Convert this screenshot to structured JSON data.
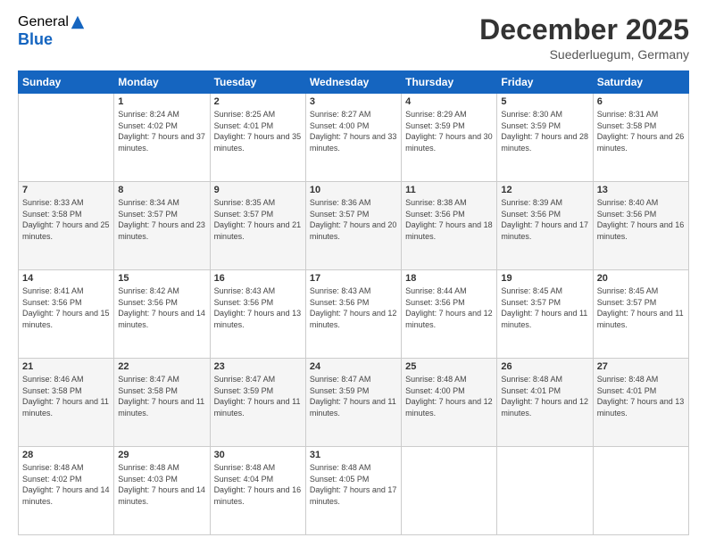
{
  "header": {
    "logo": {
      "general": "General",
      "blue": "Blue"
    },
    "title": "December 2025",
    "subtitle": "Suederluegum, Germany"
  },
  "calendar": {
    "days_of_week": [
      "Sunday",
      "Monday",
      "Tuesday",
      "Wednesday",
      "Thursday",
      "Friday",
      "Saturday"
    ],
    "weeks": [
      [
        {
          "day": "",
          "sunrise": "",
          "sunset": "",
          "daylight": ""
        },
        {
          "day": "1",
          "sunrise": "Sunrise: 8:24 AM",
          "sunset": "Sunset: 4:02 PM",
          "daylight": "Daylight: 7 hours and 37 minutes."
        },
        {
          "day": "2",
          "sunrise": "Sunrise: 8:25 AM",
          "sunset": "Sunset: 4:01 PM",
          "daylight": "Daylight: 7 hours and 35 minutes."
        },
        {
          "day": "3",
          "sunrise": "Sunrise: 8:27 AM",
          "sunset": "Sunset: 4:00 PM",
          "daylight": "Daylight: 7 hours and 33 minutes."
        },
        {
          "day": "4",
          "sunrise": "Sunrise: 8:29 AM",
          "sunset": "Sunset: 3:59 PM",
          "daylight": "Daylight: 7 hours and 30 minutes."
        },
        {
          "day": "5",
          "sunrise": "Sunrise: 8:30 AM",
          "sunset": "Sunset: 3:59 PM",
          "daylight": "Daylight: 7 hours and 28 minutes."
        },
        {
          "day": "6",
          "sunrise": "Sunrise: 8:31 AM",
          "sunset": "Sunset: 3:58 PM",
          "daylight": "Daylight: 7 hours and 26 minutes."
        }
      ],
      [
        {
          "day": "7",
          "sunrise": "Sunrise: 8:33 AM",
          "sunset": "Sunset: 3:58 PM",
          "daylight": "Daylight: 7 hours and 25 minutes."
        },
        {
          "day": "8",
          "sunrise": "Sunrise: 8:34 AM",
          "sunset": "Sunset: 3:57 PM",
          "daylight": "Daylight: 7 hours and 23 minutes."
        },
        {
          "day": "9",
          "sunrise": "Sunrise: 8:35 AM",
          "sunset": "Sunset: 3:57 PM",
          "daylight": "Daylight: 7 hours and 21 minutes."
        },
        {
          "day": "10",
          "sunrise": "Sunrise: 8:36 AM",
          "sunset": "Sunset: 3:57 PM",
          "daylight": "Daylight: 7 hours and 20 minutes."
        },
        {
          "day": "11",
          "sunrise": "Sunrise: 8:38 AM",
          "sunset": "Sunset: 3:56 PM",
          "daylight": "Daylight: 7 hours and 18 minutes."
        },
        {
          "day": "12",
          "sunrise": "Sunrise: 8:39 AM",
          "sunset": "Sunset: 3:56 PM",
          "daylight": "Daylight: 7 hours and 17 minutes."
        },
        {
          "day": "13",
          "sunrise": "Sunrise: 8:40 AM",
          "sunset": "Sunset: 3:56 PM",
          "daylight": "Daylight: 7 hours and 16 minutes."
        }
      ],
      [
        {
          "day": "14",
          "sunrise": "Sunrise: 8:41 AM",
          "sunset": "Sunset: 3:56 PM",
          "daylight": "Daylight: 7 hours and 15 minutes."
        },
        {
          "day": "15",
          "sunrise": "Sunrise: 8:42 AM",
          "sunset": "Sunset: 3:56 PM",
          "daylight": "Daylight: 7 hours and 14 minutes."
        },
        {
          "day": "16",
          "sunrise": "Sunrise: 8:43 AM",
          "sunset": "Sunset: 3:56 PM",
          "daylight": "Daylight: 7 hours and 13 minutes."
        },
        {
          "day": "17",
          "sunrise": "Sunrise: 8:43 AM",
          "sunset": "Sunset: 3:56 PM",
          "daylight": "Daylight: 7 hours and 12 minutes."
        },
        {
          "day": "18",
          "sunrise": "Sunrise: 8:44 AM",
          "sunset": "Sunset: 3:56 PM",
          "daylight": "Daylight: 7 hours and 12 minutes."
        },
        {
          "day": "19",
          "sunrise": "Sunrise: 8:45 AM",
          "sunset": "Sunset: 3:57 PM",
          "daylight": "Daylight: 7 hours and 11 minutes."
        },
        {
          "day": "20",
          "sunrise": "Sunrise: 8:45 AM",
          "sunset": "Sunset: 3:57 PM",
          "daylight": "Daylight: 7 hours and 11 minutes."
        }
      ],
      [
        {
          "day": "21",
          "sunrise": "Sunrise: 8:46 AM",
          "sunset": "Sunset: 3:58 PM",
          "daylight": "Daylight: 7 hours and 11 minutes."
        },
        {
          "day": "22",
          "sunrise": "Sunrise: 8:47 AM",
          "sunset": "Sunset: 3:58 PM",
          "daylight": "Daylight: 7 hours and 11 minutes."
        },
        {
          "day": "23",
          "sunrise": "Sunrise: 8:47 AM",
          "sunset": "Sunset: 3:59 PM",
          "daylight": "Daylight: 7 hours and 11 minutes."
        },
        {
          "day": "24",
          "sunrise": "Sunrise: 8:47 AM",
          "sunset": "Sunset: 3:59 PM",
          "daylight": "Daylight: 7 hours and 11 minutes."
        },
        {
          "day": "25",
          "sunrise": "Sunrise: 8:48 AM",
          "sunset": "Sunset: 4:00 PM",
          "daylight": "Daylight: 7 hours and 12 minutes."
        },
        {
          "day": "26",
          "sunrise": "Sunrise: 8:48 AM",
          "sunset": "Sunset: 4:01 PM",
          "daylight": "Daylight: 7 hours and 12 minutes."
        },
        {
          "day": "27",
          "sunrise": "Sunrise: 8:48 AM",
          "sunset": "Sunset: 4:01 PM",
          "daylight": "Daylight: 7 hours and 13 minutes."
        }
      ],
      [
        {
          "day": "28",
          "sunrise": "Sunrise: 8:48 AM",
          "sunset": "Sunset: 4:02 PM",
          "daylight": "Daylight: 7 hours and 14 minutes."
        },
        {
          "day": "29",
          "sunrise": "Sunrise: 8:48 AM",
          "sunset": "Sunset: 4:03 PM",
          "daylight": "Daylight: 7 hours and 14 minutes."
        },
        {
          "day": "30",
          "sunrise": "Sunrise: 8:48 AM",
          "sunset": "Sunset: 4:04 PM",
          "daylight": "Daylight: 7 hours and 16 minutes."
        },
        {
          "day": "31",
          "sunrise": "Sunrise: 8:48 AM",
          "sunset": "Sunset: 4:05 PM",
          "daylight": "Daylight: 7 hours and 17 minutes."
        },
        {
          "day": "",
          "sunrise": "",
          "sunset": "",
          "daylight": ""
        },
        {
          "day": "",
          "sunrise": "",
          "sunset": "",
          "daylight": ""
        },
        {
          "day": "",
          "sunrise": "",
          "sunset": "",
          "daylight": ""
        }
      ]
    ]
  }
}
